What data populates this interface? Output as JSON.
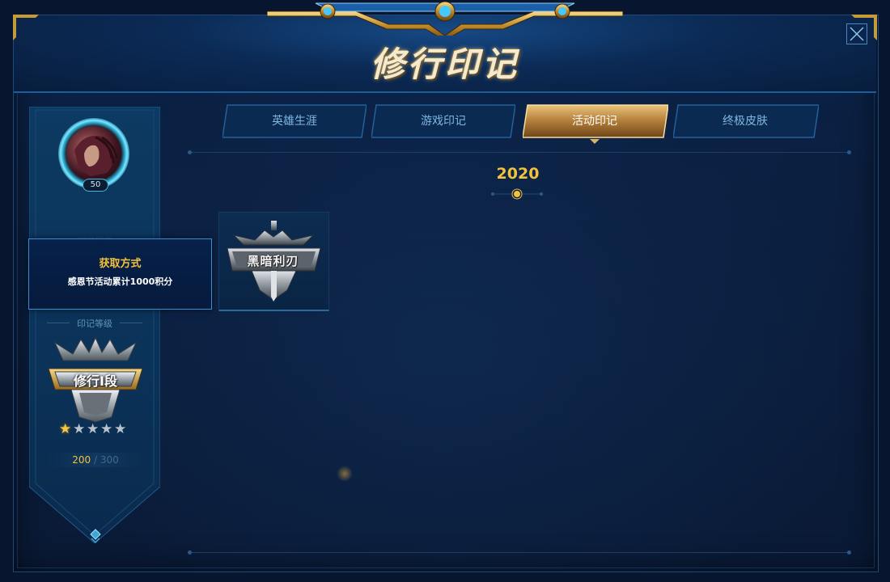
{
  "window": {
    "title": "修行印记"
  },
  "tabs": [
    {
      "label": "英雄生涯",
      "active": false
    },
    {
      "label": "游戏印记",
      "active": false
    },
    {
      "label": "活动印记",
      "active": true
    },
    {
      "label": "终极皮肤",
      "active": false
    }
  ],
  "profile": {
    "level": "50",
    "faded_label": "印记展示"
  },
  "tooltip": {
    "title": "获取方式",
    "description": "感恩节活动累计1000积分"
  },
  "mark_level": {
    "label": "印记等级",
    "rank_name": "修行Ⅰ段",
    "stars_filled": 1,
    "stars_total": 5,
    "progress_current": "200",
    "progress_separator": "/",
    "progress_max": "300"
  },
  "content": {
    "year": "2020",
    "marks": [
      {
        "name": "黑暗利刃"
      }
    ]
  },
  "colors": {
    "accent_gold": "#f1c23c",
    "tab_text": "#7fb7e0",
    "frame_border": "#1d4a78",
    "background": "#0a1a36"
  },
  "icons": {
    "close": "close-icon",
    "star": "star-icon",
    "scroll_down": "diamond-arrow-icon"
  }
}
